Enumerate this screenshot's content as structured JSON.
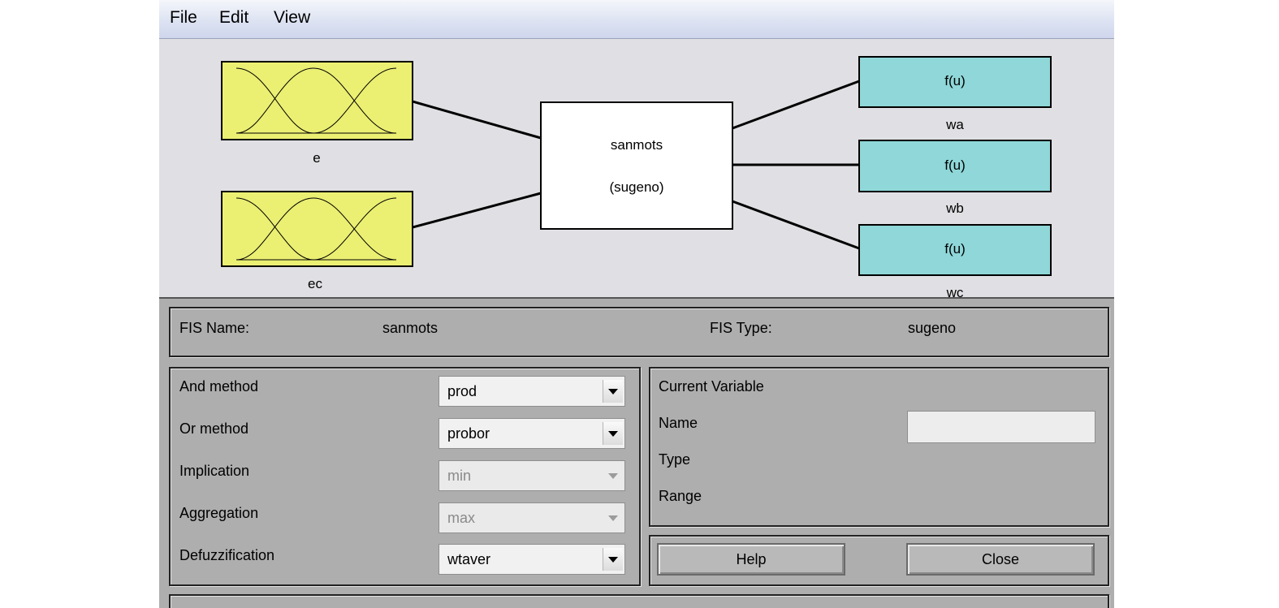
{
  "menu": {
    "file": "File",
    "edit": "Edit",
    "view": "View"
  },
  "diagram": {
    "inputs": [
      {
        "name": "e"
      },
      {
        "name": "ec"
      }
    ],
    "system": {
      "name": "sanmots",
      "type_label": "(sugeno)"
    },
    "outputs": [
      {
        "name": "wa",
        "func": "f(u)"
      },
      {
        "name": "wb",
        "func": "f(u)"
      },
      {
        "name": "wc",
        "func": "f(u)"
      }
    ],
    "colors": {
      "input_fill": "#ebef72",
      "output_fill": "#8fd7d8",
      "system_fill": "#ffffff"
    }
  },
  "fis": {
    "name_label": "FIS Name:",
    "name_value": "sanmots",
    "type_label": "FIS Type:",
    "type_value": "sugeno"
  },
  "methods": {
    "and_label": "And method",
    "and_value": "prod",
    "or_label": "Or method",
    "or_value": "probor",
    "imp_label": "Implication",
    "imp_value": "min",
    "agg_label": "Aggregation",
    "agg_value": "max",
    "defuzz_label": "Defuzzification",
    "defuzz_value": "wtaver"
  },
  "current_variable": {
    "title": "Current Variable",
    "name_label": "Name",
    "type_label": "Type",
    "range_label": "Range",
    "name_value": ""
  },
  "buttons": {
    "help": "Help",
    "close": "Close"
  }
}
